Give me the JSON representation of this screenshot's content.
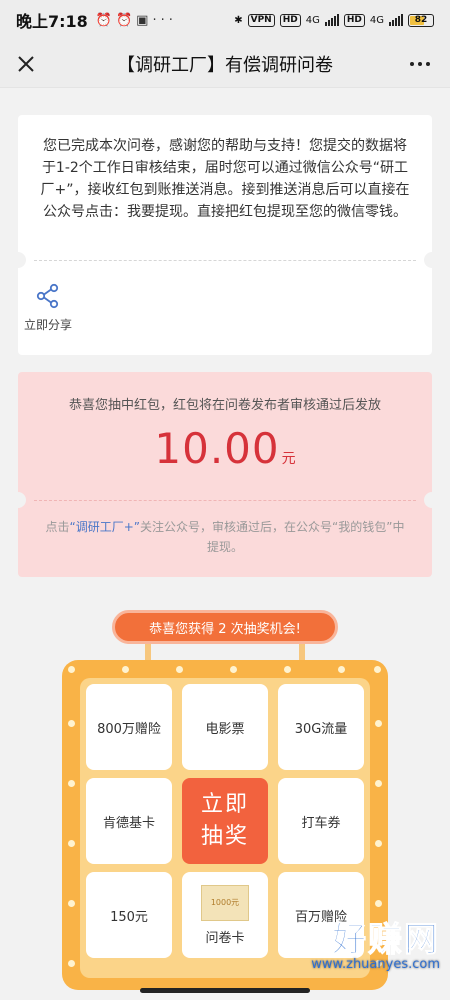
{
  "status_bar": {
    "time": "晚上7:18",
    "left_icons": [
      "alarm-icon",
      "alarm-icon",
      "gallery-icon",
      "more-icon"
    ],
    "vpn": "VPN",
    "hd1": "HD",
    "net1": "4G",
    "hd2": "HD",
    "net2": "4G",
    "battery": "82"
  },
  "navbar": {
    "title": "【调研工厂】有偿调研问卷"
  },
  "survey_card": {
    "message": "您已完成本次问卷，感谢您的帮助与支持！您提交的数据将于1-2个工作日审核结束，届时您可以通过微信公众号“研工厂+”，接收红包到账推送消息。接到推送消息后可以直接在公众号点击：我要提现。直接把红包提现至您的微信零钱。",
    "share_label": "立即分享"
  },
  "red_packet": {
    "notice": "恭喜您抽中红包，红包将在问卷发布者审核通过后发放",
    "amount": "10.00",
    "unit": "元",
    "tip_prefix": "点击",
    "tip_link": "“调研工厂+”",
    "tip_suffix": "关注公众号，审核通过后，在公众号“我的钱包”中提现。"
  },
  "lottery": {
    "chances_banner": "恭喜您获得 2 次抽奖机会!",
    "draw_button": [
      "立即",
      "抽奖"
    ],
    "prizes": [
      "800万赠险",
      "电影票",
      "30G流量",
      "肯德基卡",
      "打车券",
      "150元",
      "问卷卡",
      "百万赠险"
    ],
    "ticket_text": "1000元"
  },
  "watermark": {
    "title": "好赚网",
    "url": "www.zhuanyes.com"
  },
  "colors": {
    "accent_red": "#d6323a",
    "link_blue": "#4a76c8",
    "lottery_orange": "#f2623e",
    "board_gold": "#f9b347"
  }
}
